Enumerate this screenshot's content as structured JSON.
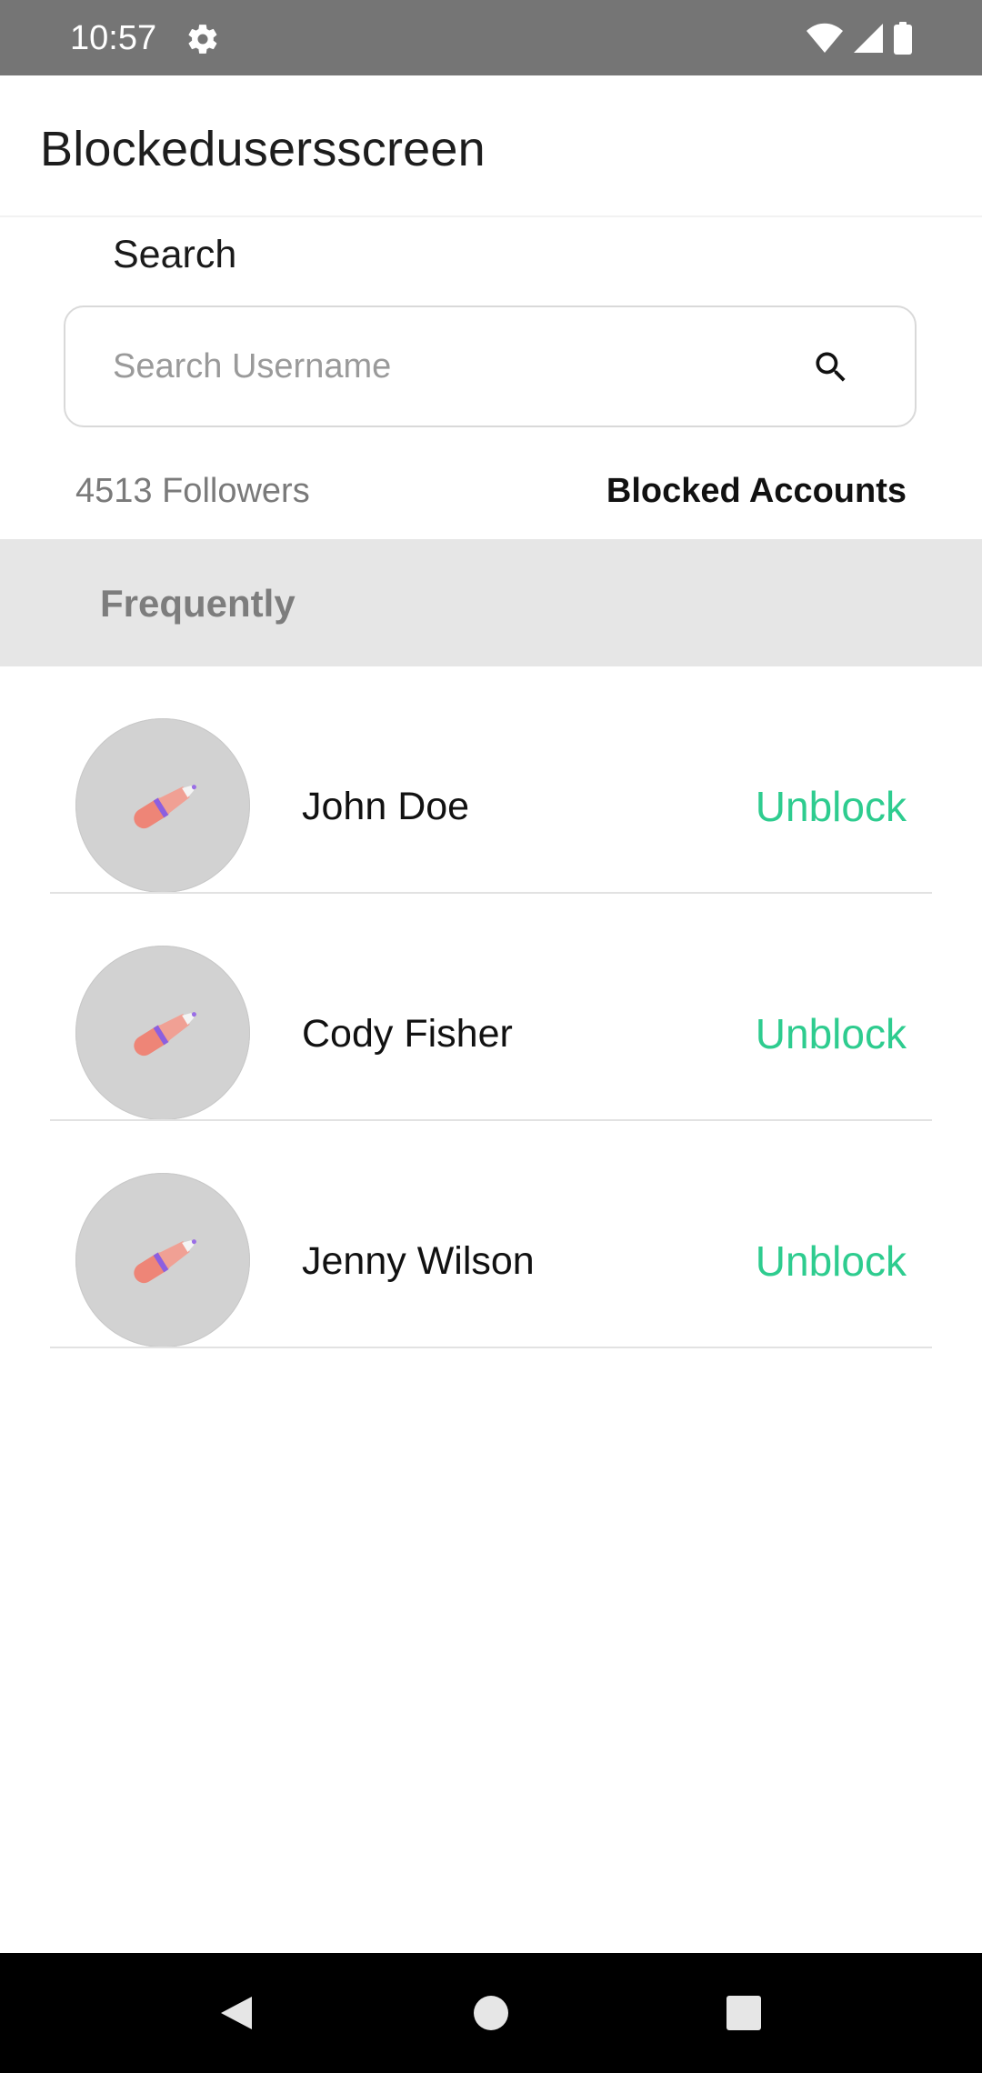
{
  "status_bar": {
    "time": "10:57",
    "icons": [
      "gear-icon",
      "wifi-icon",
      "signal-icon",
      "battery-icon"
    ]
  },
  "app_bar": {
    "title": "Blockedusersscreen"
  },
  "search": {
    "label": "Search",
    "value": "",
    "placeholder": "Search Username",
    "icon": "search-icon"
  },
  "stats": {
    "followers": "4513 Followers",
    "blocked_accounts": "Blocked Accounts"
  },
  "section": {
    "title": "Frequently"
  },
  "blocked_users": [
    {
      "name": "John Doe",
      "action": "Unblock"
    },
    {
      "name": "Cody Fisher",
      "action": "Unblock"
    },
    {
      "name": "Jenny Wilson",
      "action": "Unblock"
    }
  ],
  "colors": {
    "status_bar": "#757575",
    "accent_unblock": "#2ecc8f",
    "section_bg": "#e6e6e6",
    "avatar_bg": "#d2d2d2",
    "nav_bar": "#000000"
  },
  "nav_bar": {
    "buttons": [
      "back-icon",
      "home-icon",
      "recents-icon"
    ]
  }
}
